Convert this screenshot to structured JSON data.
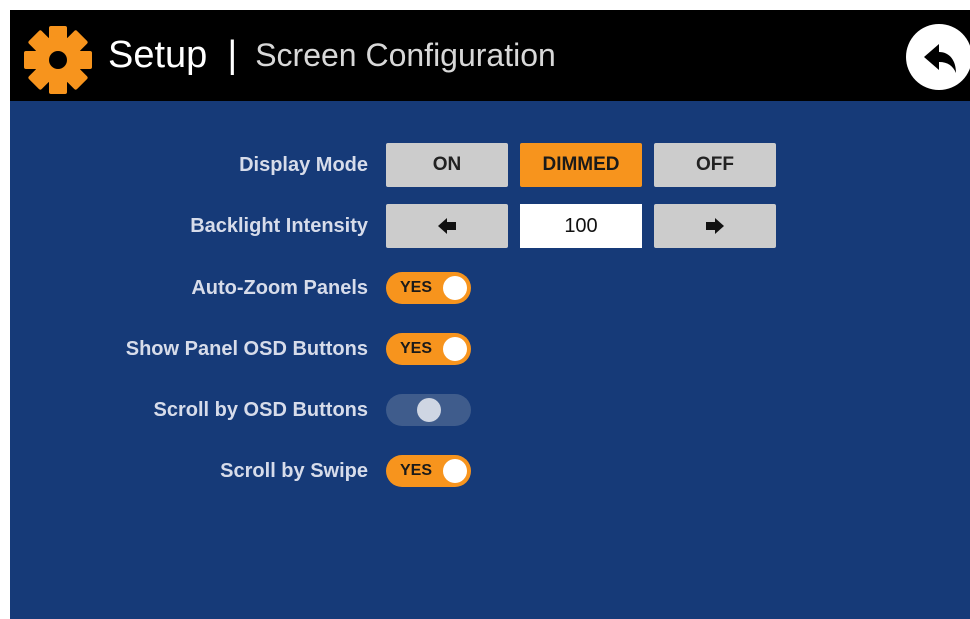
{
  "header": {
    "title": "Setup",
    "separator": "|",
    "subtitle": "Screen Configuration",
    "icon": "gear-icon",
    "back_icon": "back-arrow-icon"
  },
  "colors": {
    "accent": "#f7941d",
    "background": "#163a78",
    "header": "#000000",
    "button_inactive": "#cccccc"
  },
  "settings": {
    "display_mode": {
      "label": "Display Mode",
      "options": [
        "ON",
        "DIMMED",
        "OFF"
      ],
      "selected": "DIMMED"
    },
    "backlight": {
      "label": "Backlight Intensity",
      "value": "100",
      "decrease_icon": "arrow-left-icon",
      "increase_icon": "arrow-right-icon"
    },
    "toggles": [
      {
        "label": "Auto-Zoom Panels",
        "state": "YES",
        "on": true
      },
      {
        "label": "Show Panel OSD Buttons",
        "state": "YES",
        "on": true
      },
      {
        "label": "Scroll by OSD Buttons",
        "state": "",
        "on": false
      },
      {
        "label": "Scroll by Swipe",
        "state": "YES",
        "on": true
      }
    ]
  }
}
